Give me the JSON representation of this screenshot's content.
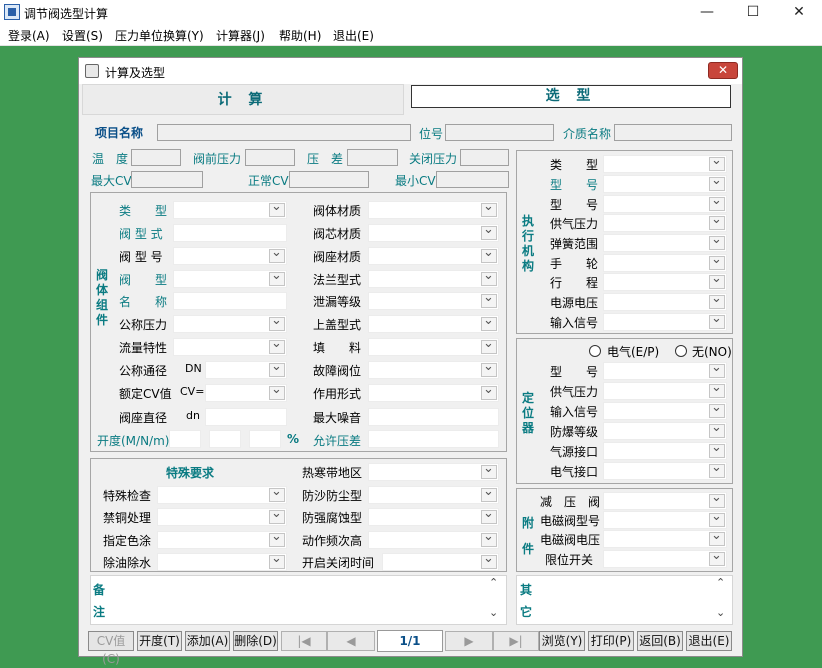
{
  "app": {
    "title": "调节阀选型计算"
  },
  "menu": [
    "登录(A)",
    "设置(S)",
    "压力单位换算(Y)",
    "计算器(J)",
    "帮助(H)",
    "退出(E)"
  ],
  "dialog": {
    "title": "计算及选型",
    "close": "✕"
  },
  "tabs": {
    "calc": "计 算",
    "select": "选 型"
  },
  "header": {
    "project": "项目名称",
    "position": "位号",
    "medium": "介质名称",
    "temp": "温　度",
    "pre_pressure": "阀前压力",
    "dp": "压　差",
    "close_pressure": "关闭压力",
    "max_cv": "最大CV",
    "normal_cv": "正常CV",
    "min_cv": "最小CV"
  },
  "valve": {
    "group": "阀体组件",
    "left": [
      "类　　型",
      "阀 型 式",
      "阀 型 号",
      "阀　　型",
      "名　　称",
      "公称压力",
      "流量特性",
      "公称通径",
      "额定CV值",
      "阀座直径"
    ],
    "dn": "DN",
    "cv_eq": "CV=",
    "dn_small": "dn",
    "right": [
      "阀体材质",
      "阀芯材质",
      "阀座材质",
      "法兰型式",
      "泄漏等级",
      "上盖型式",
      "填　　料",
      "故障阀位",
      "作用形式",
      "最大噪音"
    ],
    "opening": "开度(M/N/m)",
    "percent": "%",
    "allow_dp": "允许压差"
  },
  "special": {
    "title": "特殊要求",
    "left": [
      "特殊检查",
      "禁铜处理",
      "指定色涂",
      "除油除水"
    ],
    "right": [
      "热寒带地区",
      "防沙防尘型",
      "防强腐蚀型",
      "动作频次高",
      "开启关闭时间"
    ]
  },
  "actuator": {
    "group": "执行机构",
    "items": [
      "类　　型",
      "型　　号",
      "型　　号",
      "供气压力",
      "弹簧范围",
      "手　　轮",
      "行　　程",
      "电源电压",
      "输入信号"
    ]
  },
  "positioner": {
    "group": "定位器",
    "radio1": "电气(E/P)",
    "radio2": "无(NO)",
    "items": [
      "型　　号",
      "供气压力",
      "输入信号",
      "防爆等级",
      "气源接口",
      "电气接口"
    ]
  },
  "accessory": {
    "group": "附件",
    "items": [
      "减　压　阀",
      "电磁阀型号",
      "电磁阀电压",
      "限位开关"
    ]
  },
  "notes": {
    "remark": "备注",
    "other": "其它"
  },
  "buttons": {
    "cv": "CV值(C)",
    "opening": "开度(T)",
    "add": "添加(A)",
    "delete": "删除(D)",
    "page": "1/1",
    "browse": "浏览(Y)",
    "print": "打印(P)",
    "back": "返回(B)",
    "exit": "退出(E)"
  }
}
